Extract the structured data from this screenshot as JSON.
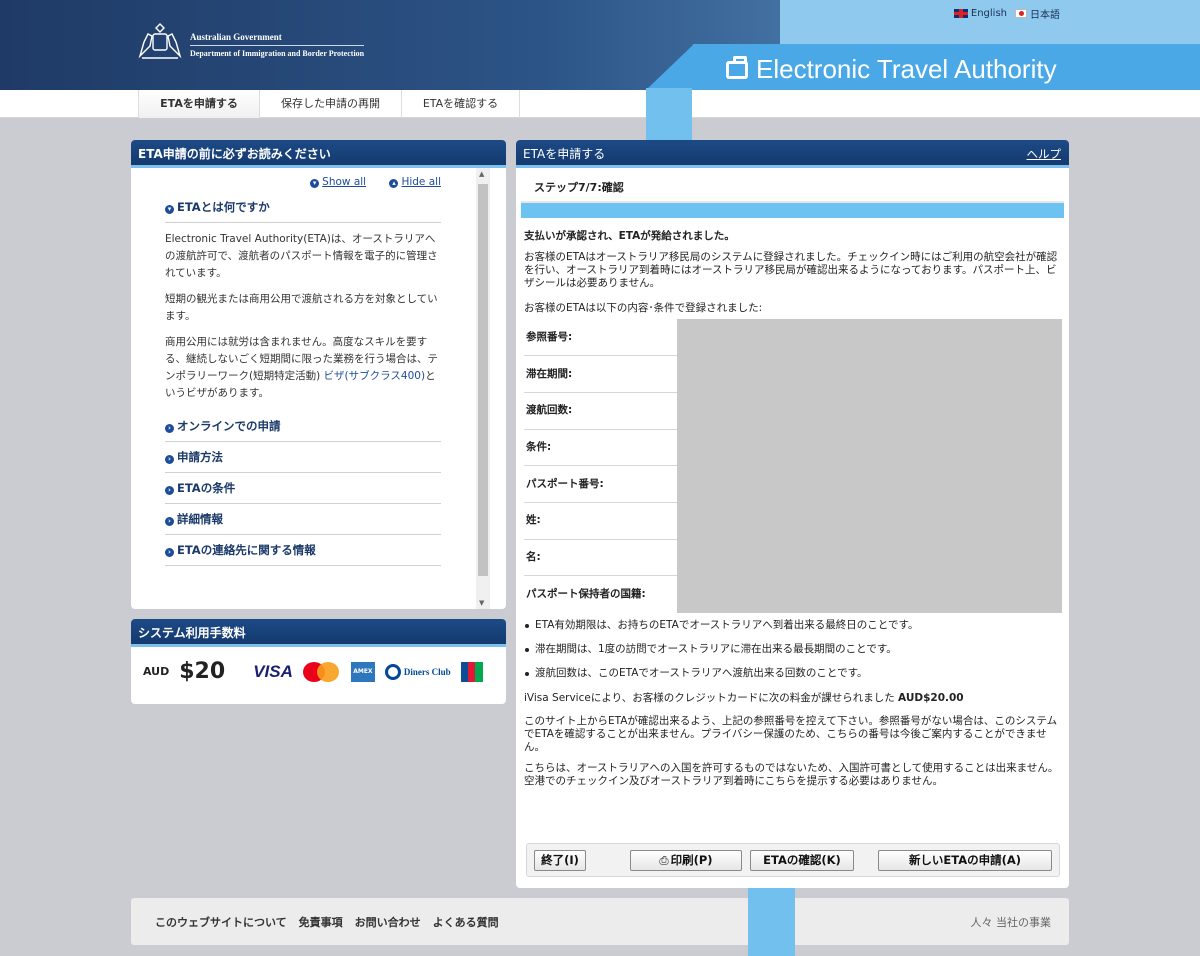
{
  "header": {
    "gov_line1": "Australian Government",
    "gov_line2": "Department of Immigration and Border Protection",
    "eta_title": "Electronic Travel Authority",
    "lang_english": "English",
    "lang_japanese": "日本語"
  },
  "nav": {
    "tabs": [
      {
        "label": "ETAを申請する",
        "active": true
      },
      {
        "label": "保存した申請の再開",
        "active": false
      },
      {
        "label": "ETAを確認する",
        "active": false
      }
    ]
  },
  "info_panel": {
    "title": "ETA申請の前に必ずお読みください",
    "show_all": "Show all",
    "hide_all": "Hide all",
    "section_title": "ETAとは何ですか",
    "para1": "Electronic Travel Authority(ETA)は、オーストラリアへの渡航許可で、渡航者のパスポート情報を電子的に管理されています。",
    "para2": "短期の観光または商用公用で渡航される方を対象としています。",
    "para3_text": "商用公用には就労は含まれません。高度なスキルを要する、継続しないごく短期間に限った業務を行う場合は、テンポラリーワーク(短期特定活動) ",
    "para3_link": "ビザ(サブクラス400)",
    "para3_tail": "というビザがあります。",
    "sections": [
      "オンラインでの申請",
      "申請方法",
      "ETAの条件",
      "詳細情報",
      "ETAの連絡先に関する情報"
    ]
  },
  "fee_panel": {
    "title": "システム利用手数料",
    "currency": "AUD",
    "amount": "$20",
    "cards": {
      "visa": "VISA",
      "diners": "Diners Club"
    }
  },
  "main_panel": {
    "title": "ETAを申請する",
    "help": "ヘルプ",
    "step": "ステップ7/7:確認",
    "progress_fraction": 1.0,
    "confirm_heading": "支払いが承認され、ETAが発給されました。",
    "confirm_text": "お客様のETAはオーストラリア移民局のシステムに登録されました。チェックイン時にはご利用の航空会社が確認を行い、オーストラリア到着時にはオーストラリア移民局が確認出来るようになっております。パスポート上、ビザシールは必要ありません。",
    "registered_text": "お客様のETAは以下の内容･条件で登録されました:",
    "details": [
      {
        "label": "参照番号:"
      },
      {
        "label": "滞在期間:"
      },
      {
        "label": "渡航回数:"
      },
      {
        "label": "条件:"
      },
      {
        "label": "パスポート番号:"
      },
      {
        "label": "姓:"
      },
      {
        "label": "名:"
      },
      {
        "label": "パスポート保持者の国籍:"
      }
    ],
    "notes": [
      "ETA有効期限は、お持ちのETAでオーストラリアへ到着出来る最終日のことです。",
      "滞在期間は、1度の訪問でオーストラリアに滞在出来る最長期間のことです。",
      "渡航回数は、このETAでオーストラリアへ渡航出来る回数のことです。"
    ],
    "charge_text": "iVisa Serviceにより、お客様のクレジットカードに次の料金が課せられました ",
    "charge_amount": "AUD$20.00",
    "ref_note": "このサイト上からETAが確認出来るよう、上記の参照番号を控えて下さい。参照番号がない場合は、このシステムでETAを確認することが出来ません。プライバシー保護のため、こちらの番号は今後ご案内することができません。",
    "entry_note": "こちらは、オーストラリアへの入国を許可するものではないため、入国許可書として使用することは出来ません。空港でのチェックイン及びオーストラリア到着時にこちらを提示する必要はありません。",
    "buttons": {
      "finish": "終了(I)",
      "print": "印刷(P)",
      "check": "ETAの確認(K)",
      "new": "新しいETAの申請(A)"
    }
  },
  "footer": {
    "links": [
      "このウェブサイトについて",
      "免責事項",
      "お問い合わせ",
      "よくある質問"
    ],
    "right": "人々 当社の事業"
  }
}
